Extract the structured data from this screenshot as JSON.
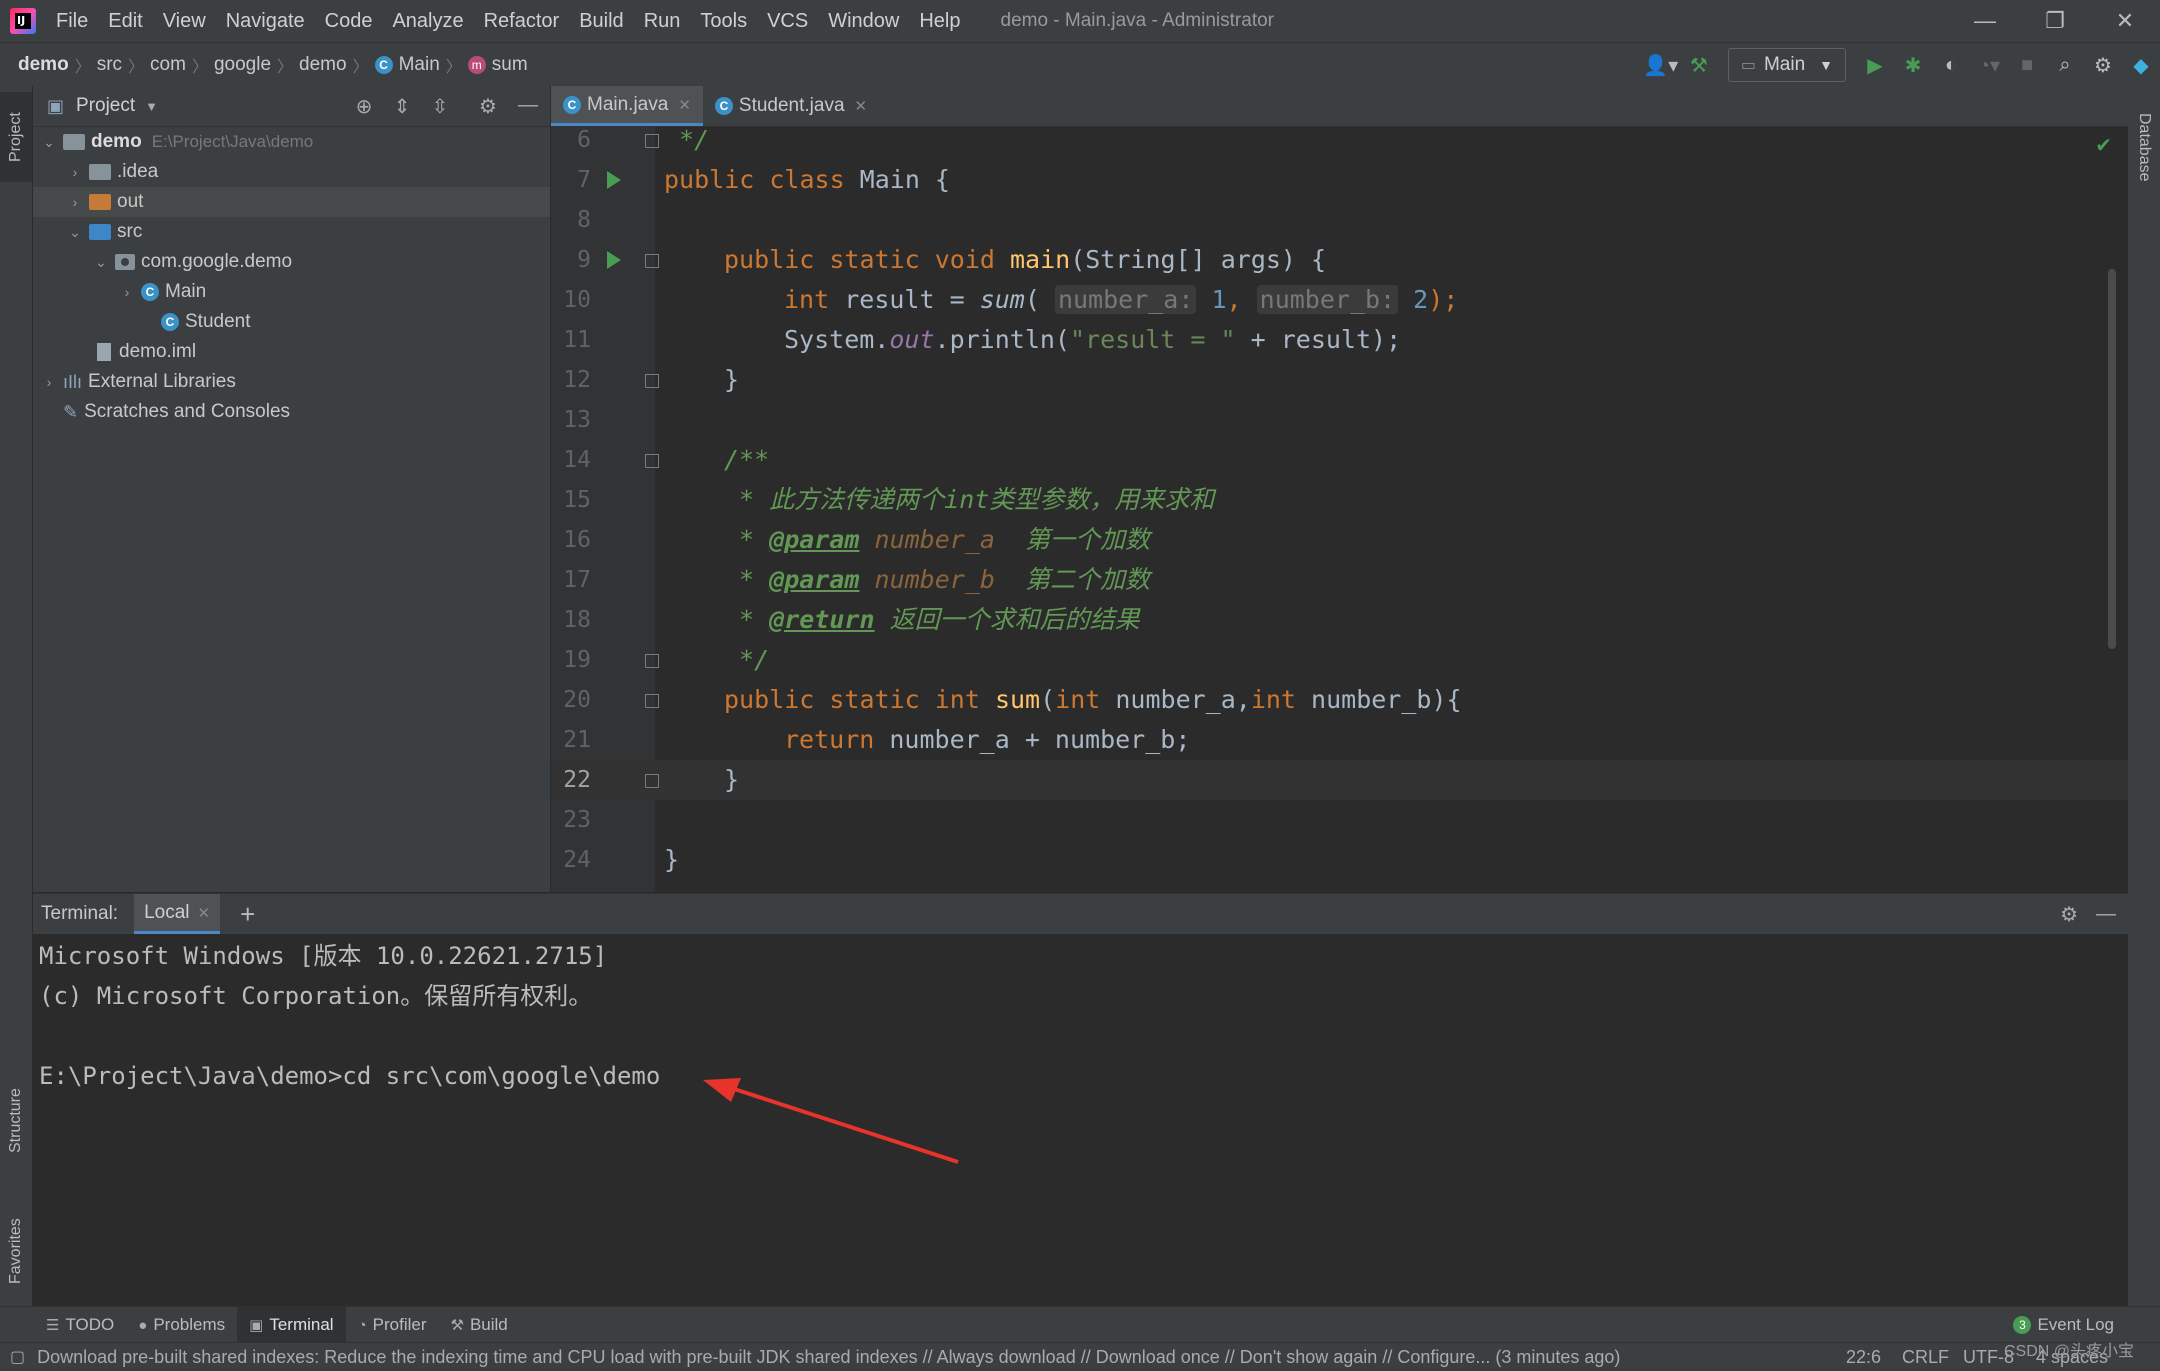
{
  "app": {
    "menu": [
      "File",
      "Edit",
      "View",
      "Navigate",
      "Code",
      "Analyze",
      "Refactor",
      "Build",
      "Run",
      "Tools",
      "VCS",
      "Window",
      "Help"
    ],
    "window_title": "demo - Main.java - Administrator",
    "logo_text": "IJ"
  },
  "breadcrumb": [
    "demo",
    "src",
    "com",
    "google",
    "demo",
    "Main",
    "sum"
  ],
  "toolbar": {
    "run_config": "Main"
  },
  "left_strip": {
    "project": "Project",
    "structure": "Structure",
    "favorites": "Favorites"
  },
  "right_strip": {
    "database": "Database"
  },
  "project": {
    "title": "Project",
    "root_name": "demo",
    "root_path": "E:\\Project\\Java\\demo",
    "items": [
      {
        "label": ".idea"
      },
      {
        "label": "out"
      },
      {
        "label": "src"
      },
      {
        "label": "com.google.demo"
      },
      {
        "label": "Main"
      },
      {
        "label": "Student"
      },
      {
        "label": "demo.iml"
      },
      {
        "label": "External Libraries"
      },
      {
        "label": "Scratches and Consoles"
      }
    ]
  },
  "editor": {
    "tabs": [
      {
        "label": "Main.java"
      },
      {
        "label": "Student.java"
      }
    ],
    "line_numbers": [
      "6",
      "7",
      "8",
      "9",
      "10",
      "11",
      "12",
      "13",
      "14",
      "15",
      "16",
      "17",
      "18",
      "19",
      "20",
      "21",
      "22",
      "23",
      "24"
    ],
    "code": {
      "l6": " */",
      "l7_kw": "public class ",
      "l7_rest": "Main {",
      "l9_kw": "public static void ",
      "l9_fn": "main",
      "l9_rest": "(String[] args) {",
      "l10_kw": "int ",
      "l10_a": "result = ",
      "l10_fn": "sum",
      "l10_b": "( ",
      "l10_h1": "number_a:",
      "l10_v1": " 1",
      "l10_c": ", ",
      "l10_h2": "number_b:",
      "l10_v2": " 2",
      "l10_d": ");",
      "l11_a": "System.",
      "l11_out": "out",
      "l11_b": ".println(",
      "l11_str": "\"result = \"",
      "l11_c": " + result);",
      "l12": "}",
      "l14": "/**",
      "l15": " * 此方法传递两个int类型参数，用来求和",
      "l16_a": " * ",
      "l16_tag": "@param",
      "l16_p": " number_a",
      "l16_t": "  第一个加数",
      "l17_a": " * ",
      "l17_tag": "@param",
      "l17_p": " number_b",
      "l17_t": "  第二个加数",
      "l18_a": " * ",
      "l18_tag": "@return",
      "l18_t": " 返回一个求和后的结果",
      "l19": " */",
      "l20_kw": "public static int ",
      "l20_fn": "sum",
      "l20_a": "(",
      "l20_k2": "int",
      "l20_b": " number_a,",
      "l20_k3": "int",
      "l20_c": " number_b){",
      "l21_kw": "return ",
      "l21_a": "number_a + number_b;",
      "l22": "}",
      "l24": "}"
    }
  },
  "terminal": {
    "label": "Terminal:",
    "tab": "Local",
    "lines": [
      "Microsoft Windows [版本 10.0.22621.2715]",
      "(c) Microsoft Corporation。保留所有权利。",
      "",
      "E:\\Project\\Java\\demo>cd src\\com\\google\\demo"
    ]
  },
  "bottom_tabs": [
    "TODO",
    "Problems",
    "Terminal",
    "Profiler",
    "Build"
  ],
  "event_log": {
    "label": "Event Log",
    "count": "3"
  },
  "status": {
    "message": "Download pre-built shared indexes: Reduce the indexing time and CPU load with pre-built JDK shared indexes // Always download // Download once // Don't show again // Configure... (3 minutes ago)",
    "position": "22:6",
    "line_sep": "CRLF",
    "encoding": "UTF-8",
    "indent": "4 spaces",
    "watermark": "CSDN @头疼小宝"
  },
  "colors": {
    "accent": "#4a88c7",
    "run": "#499c54",
    "annotation_arrow": "#e8332a"
  }
}
